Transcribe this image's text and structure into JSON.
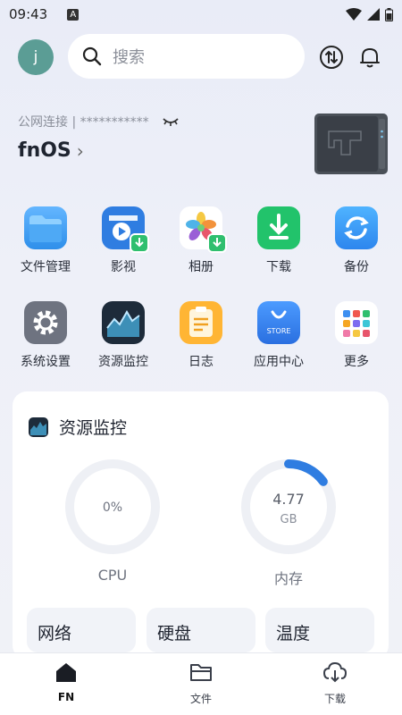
{
  "status_bar": {
    "time": "09:43",
    "a_icon": "A"
  },
  "header": {
    "avatar_initial": "j",
    "search_placeholder": "搜索",
    "icons": [
      "transfer-icon",
      "bell-icon"
    ]
  },
  "host": {
    "connection_label": "公网连接 | ***********",
    "name": "fnOS",
    "chevron": "›"
  },
  "apps": [
    {
      "label": "文件管理",
      "icon": "folder-icon"
    },
    {
      "label": "影视",
      "icon": "video-icon"
    },
    {
      "label": "相册",
      "icon": "photos-icon"
    },
    {
      "label": "下载",
      "icon": "download-icon"
    },
    {
      "label": "备份",
      "icon": "backup-icon"
    },
    {
      "label": "系统设置",
      "icon": "gear-icon"
    },
    {
      "label": "资源监控",
      "icon": "monitor-icon"
    },
    {
      "label": "日志",
      "icon": "log-icon"
    },
    {
      "label": "应用中心",
      "icon": "store-icon",
      "badge_text": "STORE"
    },
    {
      "label": "更多",
      "icon": "more-icon"
    }
  ],
  "monitor": {
    "title": "资源监控",
    "cpu": {
      "value": "0%",
      "label": "CPU",
      "fraction": 0
    },
    "memory": {
      "value": "4.77",
      "unit": "GB",
      "label": "内存",
      "fraction": 0.15
    },
    "sub_cards": [
      "网络",
      "硬盘",
      "温度"
    ]
  },
  "tabbar": {
    "tabs": [
      {
        "label": "FN",
        "icon": "home-icon",
        "active": true
      },
      {
        "label": "文件",
        "icon": "folder-outline-icon",
        "active": false
      },
      {
        "label": "下载",
        "icon": "cloud-download-icon",
        "active": false
      }
    ]
  },
  "colors": {
    "accent": "#2f7de1",
    "avatar": "#5b9d95",
    "ring_track": "#eef0f5"
  }
}
